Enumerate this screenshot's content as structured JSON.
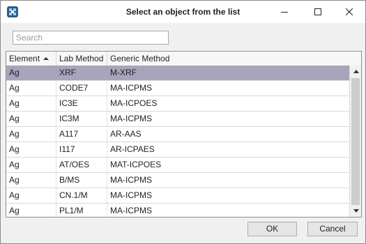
{
  "window": {
    "title": "Select an object from the list",
    "icon": "app-logo-icon",
    "controls": [
      "minimize-icon",
      "maximize-icon",
      "close-icon"
    ]
  },
  "search": {
    "placeholder": "Search",
    "value": ""
  },
  "table": {
    "columns": [
      {
        "label": "Element",
        "sort": "ascending"
      },
      {
        "label": "Lab Method"
      },
      {
        "label": "Generic Method"
      }
    ],
    "selected_index": 0,
    "rows": [
      {
        "element": "Ag",
        "lab_method": "XRF",
        "generic_method": "M-XRF"
      },
      {
        "element": "Ag",
        "lab_method": "CODE7",
        "generic_method": "MA-ICPMS"
      },
      {
        "element": "Ag",
        "lab_method": "IC3E",
        "generic_method": "MA-ICPOES"
      },
      {
        "element": "Ag",
        "lab_method": "IC3M",
        "generic_method": "MA-ICPMS"
      },
      {
        "element": "Ag",
        "lab_method": "A117",
        "generic_method": "AR-AAS"
      },
      {
        "element": "Ag",
        "lab_method": "I117",
        "generic_method": "AR-ICPAES"
      },
      {
        "element": "Ag",
        "lab_method": "AT/OES",
        "generic_method": "MAT-ICPOES"
      },
      {
        "element": "Ag",
        "lab_method": "B/MS",
        "generic_method": "MA-ICPMS"
      },
      {
        "element": "Ag",
        "lab_method": "CN.1/M",
        "generic_method": "MA-ICPMS"
      },
      {
        "element": "Ag",
        "lab_method": "PL1/M",
        "generic_method": "MA-ICPMS"
      }
    ]
  },
  "buttons": {
    "ok": "OK",
    "cancel": "Cancel"
  },
  "colors": {
    "selected_row": "#a9a3bb",
    "app_icon": "#2b5d8c"
  }
}
